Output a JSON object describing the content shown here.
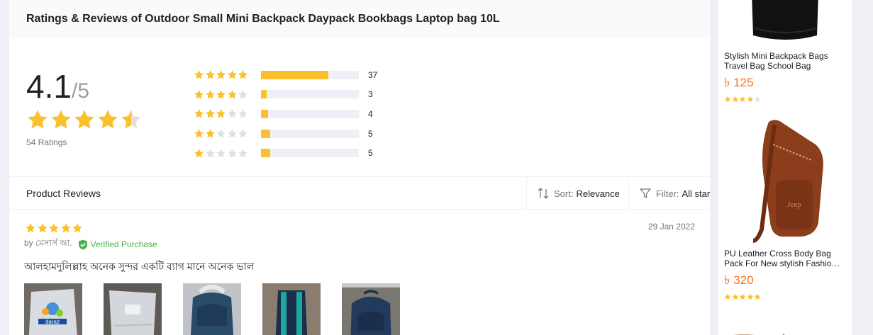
{
  "review_panel": {
    "title": "Ratings & Reviews of Outdoor Small Mini Backpack Daypack Bookbags Laptop bag 10L",
    "average": "4.1",
    "max": "/5",
    "average_rating": 4.1,
    "ratings_count": "54 Ratings",
    "distribution": [
      {
        "stars": 5,
        "count": "37",
        "fraction": 0.69
      },
      {
        "stars": 4,
        "count": "3",
        "fraction": 0.056
      },
      {
        "stars": 3,
        "count": "4",
        "fraction": 0.074
      },
      {
        "stars": 2,
        "count": "5",
        "fraction": 0.093
      },
      {
        "stars": 1,
        "count": "5",
        "fraction": 0.093
      }
    ]
  },
  "reviews_header": {
    "label": "Product Reviews",
    "sort_label": "Sort:",
    "sort_value": "Relevance",
    "filter_label": "Filter:",
    "filter_value": "All star"
  },
  "review": {
    "stars": 5,
    "date": "29 Jan 2022",
    "author": "by মেসার্স আ.",
    "verified": "Verified Purchase",
    "text": "আলহামদুলিল্লাহ অনেক সুন্দর একটি ব্যাগ মানে অনেক ভাল",
    "images": [
      "package-photo",
      "package-photo",
      "backpack-photo",
      "backpack-photo",
      "backpack-photo"
    ]
  },
  "sidebar": {
    "products": [
      {
        "title_line1": "Stylish Mini Backpack Bags",
        "title_line2": "Travel Bag School Bag",
        "price": "৳ 125",
        "stars": 4
      },
      {
        "title_line1": "PU Leather Cross Body Bag",
        "title_line2": "Pack For New stylish Fashion…",
        "price": "৳ 320",
        "stars": 5
      }
    ]
  },
  "colors": {
    "star": "#fbc02d",
    "star_empty": "#e0e0e0",
    "price": "#f57224",
    "verified": "#4caf50"
  }
}
